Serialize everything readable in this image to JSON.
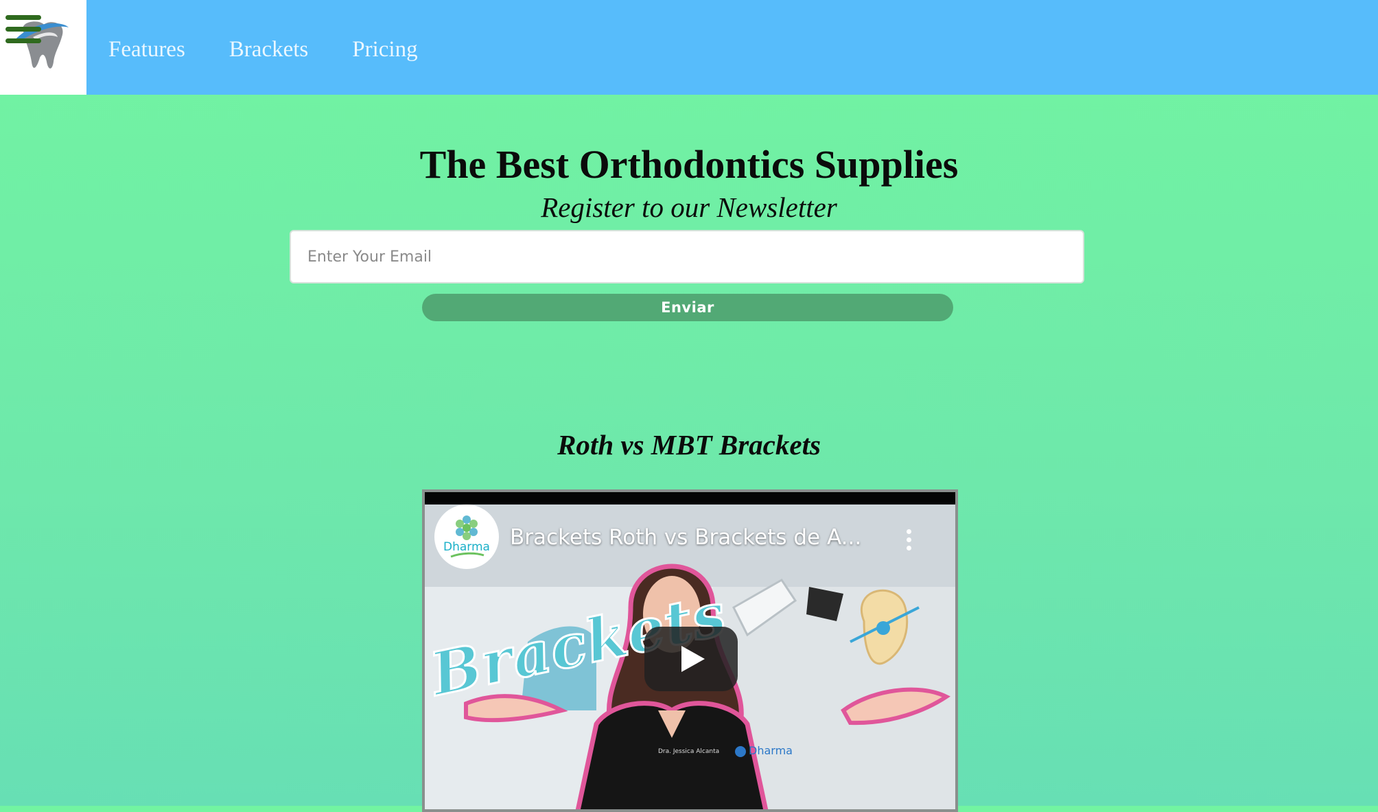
{
  "nav": {
    "menu_icon": "hamburger-menu-icon",
    "logo_icon": "tooth-logo-icon",
    "links": [
      {
        "label": "Features"
      },
      {
        "label": "Brackets"
      },
      {
        "label": "Pricing"
      }
    ]
  },
  "hero": {
    "title": "The Best Orthodontics Supplies",
    "subtitle": "Register to our Newsletter",
    "email_placeholder": "Enter Your Email",
    "submit_label": "Enviar"
  },
  "video_section": {
    "heading": "Roth vs MBT Brackets",
    "video": {
      "channel_name": "Dharma",
      "title": "Brackets Roth vs Brackets de A...",
      "thumbnail_text": "Brackets",
      "play_icon": "play-icon",
      "more_icon": "more-vertical-icon"
    }
  },
  "colors": {
    "header": "#57bcfb",
    "background_top": "#72f4a1",
    "background_bottom": "#67dfb4",
    "button": "#52a975",
    "menu_icon": "#2f6a1e"
  }
}
